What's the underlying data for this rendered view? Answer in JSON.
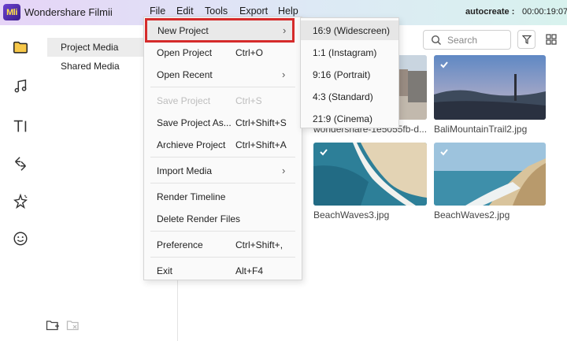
{
  "app": {
    "logo_text": "Mli",
    "title": "Wondershare Filmii",
    "project_name": "autocreate :",
    "timecode": "00:00:19:07"
  },
  "menubar": [
    "File",
    "Edit",
    "Tools",
    "Export",
    "Help"
  ],
  "sidebar": {
    "items": [
      {
        "label": "Project Media",
        "active": true
      },
      {
        "label": "Shared Media",
        "active": false
      }
    ]
  },
  "search": {
    "placeholder": "Search"
  },
  "media": [
    {
      "name": "wondershare-1e5055fb-d...",
      "checked": true
    },
    {
      "name": "BaliMountainTrail2.jpg",
      "checked": true
    },
    {
      "name": "BeachWaves3.jpg",
      "checked": true
    },
    {
      "name": "BeachWaves2.jpg",
      "checked": true
    }
  ],
  "file_menu": [
    {
      "label": "New Project",
      "shortcut": "",
      "submenu": true,
      "highlighted": true
    },
    {
      "label": "Open Project",
      "shortcut": "Ctrl+O"
    },
    {
      "label": "Open Recent",
      "shortcut": "",
      "submenu": true
    },
    {
      "label": "Save Project",
      "shortcut": "Ctrl+S",
      "disabled": true
    },
    {
      "label": "Save Project As...",
      "shortcut": "Ctrl+Shift+S"
    },
    {
      "label": "Archieve Project",
      "shortcut": "Ctrl+Shift+A"
    },
    {
      "label": "Import Media",
      "shortcut": "",
      "submenu": true
    },
    {
      "label": "Render Timeline",
      "shortcut": ""
    },
    {
      "label": "Delete Render Files",
      "shortcut": ""
    },
    {
      "label": "Preference",
      "shortcut": "Ctrl+Shift+,"
    },
    {
      "label": "Exit",
      "shortcut": "Alt+F4"
    }
  ],
  "new_project_submenu": [
    "16:9 (Widescreen)",
    "1:1 (Instagram)",
    "9:16 (Portrait)",
    "4:3 (Standard)",
    "21:9 (Cinema)"
  ],
  "colors": {
    "highlight_border": "#d52b2b",
    "accent_logo": "#6b3fd0"
  }
}
